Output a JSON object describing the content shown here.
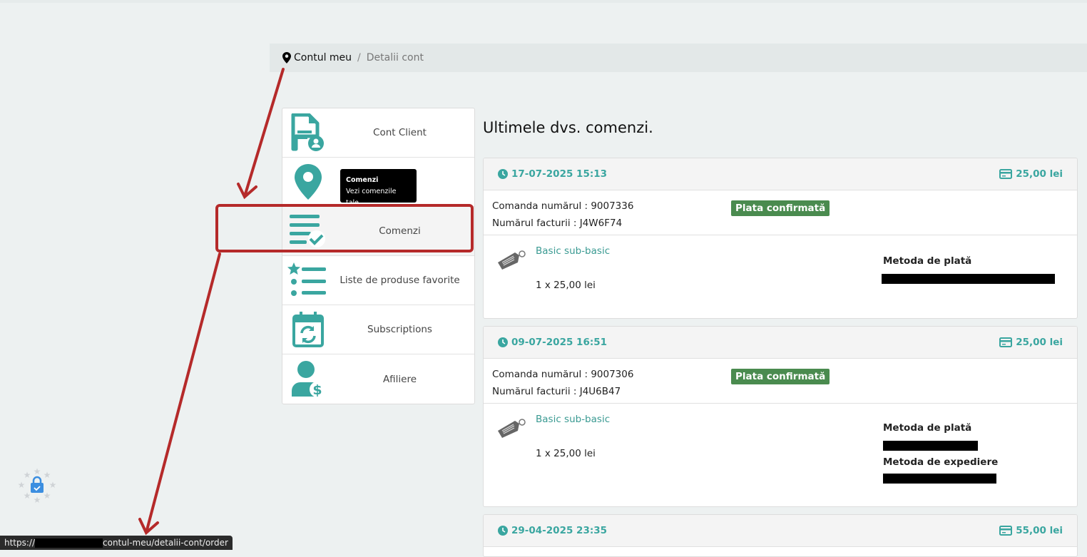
{
  "breadcrumb": {
    "home": "Contul meu",
    "sep": "/",
    "current": "Detalii cont"
  },
  "sidebar": {
    "items": [
      {
        "label": "Cont Client",
        "icon": "document-user-icon"
      },
      {
        "label": "",
        "icon": "map-pin-icon"
      },
      {
        "label": "Comenzi",
        "icon": "list-check-icon"
      },
      {
        "label": "Liste de produse favorite",
        "icon": "star-list-icon"
      },
      {
        "label": "Subscriptions",
        "icon": "calendar-refresh-icon"
      },
      {
        "label": "Afiliere",
        "icon": "user-dollar-icon"
      }
    ]
  },
  "tooltip": {
    "title": "Comenzi",
    "text": "Vezi comenzile tale"
  },
  "main": {
    "title": "Ultimele dvs. comenzi.",
    "orders": [
      {
        "date": "17-07-2025 15:13",
        "total": "25,00 lei",
        "number": "Comanda numărul : 9007336",
        "invoice": "Numărul facturii : J4W6F74",
        "status": "Plata confirmată",
        "product": "Basic sub-basic",
        "qty": "1 x 25,00 lei",
        "payment_label": "Metoda de plată"
      },
      {
        "date": "09-07-2025 16:51",
        "total": "25,00 lei",
        "number": "Comanda numărul : 9007306",
        "invoice": "Numărul facturii : J4U6B47",
        "status": "Plata confirmată",
        "product": "Basic sub-basic",
        "qty": "1 x 25,00 lei",
        "payment_label": "Metoda de plată",
        "shipping_label": "Metoda de expediere"
      },
      {
        "date": "29-04-2025 23:35",
        "total": "55,00 lei"
      }
    ]
  },
  "statusbar": {
    "prefix": "https://",
    "suffix": "contul-meu/detalii-cont/order"
  },
  "colors": {
    "accent": "#3aa6a0",
    "badge": "#4a8b4f",
    "annotation": "#b52a2a"
  }
}
